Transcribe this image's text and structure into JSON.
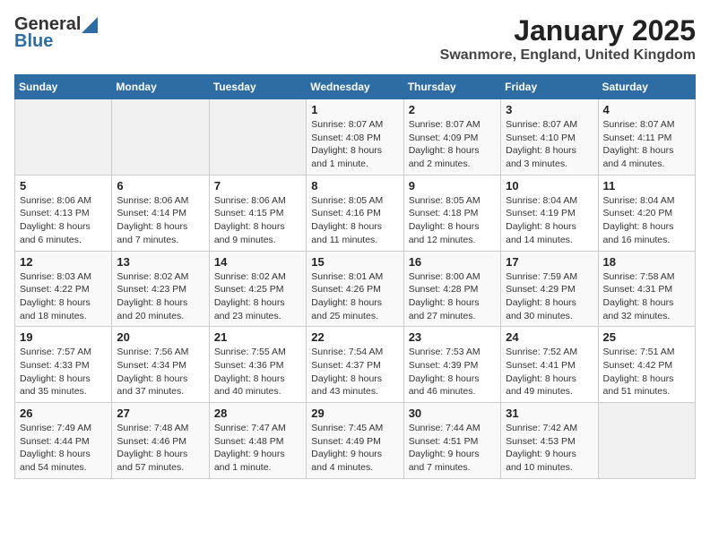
{
  "header": {
    "logo_general": "General",
    "logo_blue": "Blue",
    "month": "January 2025",
    "location": "Swanmore, England, United Kingdom"
  },
  "weekdays": [
    "Sunday",
    "Monday",
    "Tuesday",
    "Wednesday",
    "Thursday",
    "Friday",
    "Saturday"
  ],
  "weeks": [
    [
      {
        "day": "",
        "info": ""
      },
      {
        "day": "",
        "info": ""
      },
      {
        "day": "",
        "info": ""
      },
      {
        "day": "1",
        "info": "Sunrise: 8:07 AM\nSunset: 4:08 PM\nDaylight: 8 hours and 1 minute."
      },
      {
        "day": "2",
        "info": "Sunrise: 8:07 AM\nSunset: 4:09 PM\nDaylight: 8 hours and 2 minutes."
      },
      {
        "day": "3",
        "info": "Sunrise: 8:07 AM\nSunset: 4:10 PM\nDaylight: 8 hours and 3 minutes."
      },
      {
        "day": "4",
        "info": "Sunrise: 8:07 AM\nSunset: 4:11 PM\nDaylight: 8 hours and 4 minutes."
      }
    ],
    [
      {
        "day": "5",
        "info": "Sunrise: 8:06 AM\nSunset: 4:13 PM\nDaylight: 8 hours and 6 minutes."
      },
      {
        "day": "6",
        "info": "Sunrise: 8:06 AM\nSunset: 4:14 PM\nDaylight: 8 hours and 7 minutes."
      },
      {
        "day": "7",
        "info": "Sunrise: 8:06 AM\nSunset: 4:15 PM\nDaylight: 8 hours and 9 minutes."
      },
      {
        "day": "8",
        "info": "Sunrise: 8:05 AM\nSunset: 4:16 PM\nDaylight: 8 hours and 11 minutes."
      },
      {
        "day": "9",
        "info": "Sunrise: 8:05 AM\nSunset: 4:18 PM\nDaylight: 8 hours and 12 minutes."
      },
      {
        "day": "10",
        "info": "Sunrise: 8:04 AM\nSunset: 4:19 PM\nDaylight: 8 hours and 14 minutes."
      },
      {
        "day": "11",
        "info": "Sunrise: 8:04 AM\nSunset: 4:20 PM\nDaylight: 8 hours and 16 minutes."
      }
    ],
    [
      {
        "day": "12",
        "info": "Sunrise: 8:03 AM\nSunset: 4:22 PM\nDaylight: 8 hours and 18 minutes."
      },
      {
        "day": "13",
        "info": "Sunrise: 8:02 AM\nSunset: 4:23 PM\nDaylight: 8 hours and 20 minutes."
      },
      {
        "day": "14",
        "info": "Sunrise: 8:02 AM\nSunset: 4:25 PM\nDaylight: 8 hours and 23 minutes."
      },
      {
        "day": "15",
        "info": "Sunrise: 8:01 AM\nSunset: 4:26 PM\nDaylight: 8 hours and 25 minutes."
      },
      {
        "day": "16",
        "info": "Sunrise: 8:00 AM\nSunset: 4:28 PM\nDaylight: 8 hours and 27 minutes."
      },
      {
        "day": "17",
        "info": "Sunrise: 7:59 AM\nSunset: 4:29 PM\nDaylight: 8 hours and 30 minutes."
      },
      {
        "day": "18",
        "info": "Sunrise: 7:58 AM\nSunset: 4:31 PM\nDaylight: 8 hours and 32 minutes."
      }
    ],
    [
      {
        "day": "19",
        "info": "Sunrise: 7:57 AM\nSunset: 4:33 PM\nDaylight: 8 hours and 35 minutes."
      },
      {
        "day": "20",
        "info": "Sunrise: 7:56 AM\nSunset: 4:34 PM\nDaylight: 8 hours and 37 minutes."
      },
      {
        "day": "21",
        "info": "Sunrise: 7:55 AM\nSunset: 4:36 PM\nDaylight: 8 hours and 40 minutes."
      },
      {
        "day": "22",
        "info": "Sunrise: 7:54 AM\nSunset: 4:37 PM\nDaylight: 8 hours and 43 minutes."
      },
      {
        "day": "23",
        "info": "Sunrise: 7:53 AM\nSunset: 4:39 PM\nDaylight: 8 hours and 46 minutes."
      },
      {
        "day": "24",
        "info": "Sunrise: 7:52 AM\nSunset: 4:41 PM\nDaylight: 8 hours and 49 minutes."
      },
      {
        "day": "25",
        "info": "Sunrise: 7:51 AM\nSunset: 4:42 PM\nDaylight: 8 hours and 51 minutes."
      }
    ],
    [
      {
        "day": "26",
        "info": "Sunrise: 7:49 AM\nSunset: 4:44 PM\nDaylight: 8 hours and 54 minutes."
      },
      {
        "day": "27",
        "info": "Sunrise: 7:48 AM\nSunset: 4:46 PM\nDaylight: 8 hours and 57 minutes."
      },
      {
        "day": "28",
        "info": "Sunrise: 7:47 AM\nSunset: 4:48 PM\nDaylight: 9 hours and 1 minute."
      },
      {
        "day": "29",
        "info": "Sunrise: 7:45 AM\nSunset: 4:49 PM\nDaylight: 9 hours and 4 minutes."
      },
      {
        "day": "30",
        "info": "Sunrise: 7:44 AM\nSunset: 4:51 PM\nDaylight: 9 hours and 7 minutes."
      },
      {
        "day": "31",
        "info": "Sunrise: 7:42 AM\nSunset: 4:53 PM\nDaylight: 9 hours and 10 minutes."
      },
      {
        "day": "",
        "info": ""
      }
    ]
  ]
}
